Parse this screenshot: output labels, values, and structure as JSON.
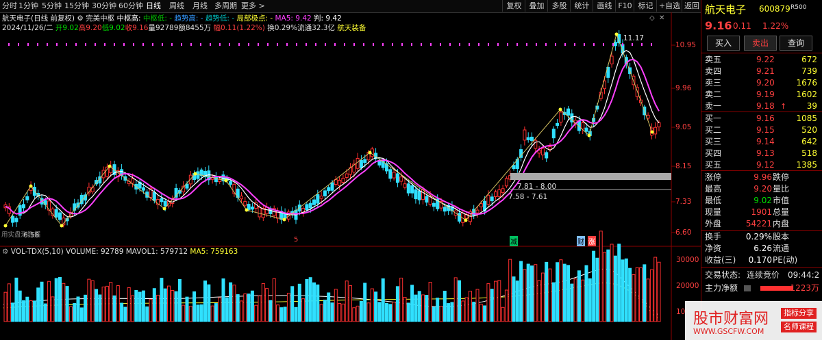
{
  "toolbar": {
    "periods": [
      "分时",
      "1分钟",
      "5分钟",
      "15分钟",
      "30分钟",
      "60分钟",
      "日线",
      "周线",
      "月线",
      "多周期",
      "更多 >"
    ],
    "active_period": "日线",
    "tools": [
      "复权",
      "叠加",
      "多股",
      "统计",
      "画线",
      "F10",
      "标记",
      "+自选",
      "返回"
    ]
  },
  "chart_header": {
    "line1": {
      "stock": "航天电子(日线 前复权)",
      "indicator": "完美中枢",
      "zhongshu_high": "中枢高:",
      "zhongshu_low": "中枢低:",
      "zhongshu_low_val": "-",
      "trend_high": "趋势高:",
      "trend_high_val": "-",
      "trend_low": "趋势低:",
      "trend_low_val": "-",
      "extreme": "局部极点:",
      "extreme_val": "-",
      "ma5": "MA5: 9.42",
      "judge": "判: 9.42"
    },
    "line2": {
      "date": "2024/11/26/二",
      "open": "开9.02",
      "high": "高9.20",
      "low": "低9.02",
      "close": "收9.16",
      "volume": "量92789",
      "amount": "额8455万",
      "change": "幅0.11(1.22%)",
      "turnover": "换0.29%",
      "float": "流通32.3亿",
      "sector": "航天装备"
    }
  },
  "price_axis": [
    "10.95",
    "9.96",
    "9.05",
    "8.15",
    "7.33",
    "6.60"
  ],
  "volume_axis": [
    "30000",
    "20000",
    "10"
  ],
  "annotations": {
    "peak": "11.17",
    "low": "6.58",
    "range1": "7.81 - 8.00",
    "range2": "7.58 - 7.61",
    "left_note": "用实盘测数据",
    "markers": [
      "5",
      "减",
      "财",
      "涨"
    ]
  },
  "volume_header": {
    "name": "VOL-TDX(5,10)",
    "volume": "VOLUME: 92789",
    "mavol1": "MAVOL1: 579712",
    "ma5": "MA5: 759163"
  },
  "right_panel": {
    "name": "航天电子",
    "code": "600879",
    "badge": "R500",
    "price": "9.16",
    "change": "0.11",
    "pct": "1.22%",
    "buttons": [
      "买入",
      "卖出",
      "查询"
    ],
    "asks": [
      {
        "label": "卖五",
        "price": "9.22",
        "vol": "672"
      },
      {
        "label": "卖四",
        "price": "9.21",
        "vol": "739"
      },
      {
        "label": "卖三",
        "price": "9.20",
        "vol": "1676"
      },
      {
        "label": "卖二",
        "price": "9.19",
        "vol": "1602"
      },
      {
        "label": "卖一",
        "price": "9.18",
        "vol": "39"
      }
    ],
    "bids": [
      {
        "label": "买一",
        "price": "9.16",
        "vol": "1085"
      },
      {
        "label": "买二",
        "price": "9.15",
        "vol": "520"
      },
      {
        "label": "买三",
        "price": "9.14",
        "vol": "642"
      },
      {
        "label": "买四",
        "price": "9.13",
        "vol": "518"
      },
      {
        "label": "买五",
        "price": "9.12",
        "vol": "1385"
      }
    ],
    "stats": [
      {
        "l1": "涨停",
        "v1": "9.96",
        "l2": "跌停",
        "v2": ""
      },
      {
        "l1": "最高",
        "v1": "9.20",
        "l2": "量比",
        "v2": ""
      },
      {
        "l1": "最低",
        "v1": "9.02",
        "l2": "市值",
        "v2": ""
      },
      {
        "l1": "现量",
        "v1": "1901",
        "l2": "总量",
        "v2": ""
      },
      {
        "l1": "外盘",
        "v1": "54221",
        "l2": "内盘",
        "v2": ""
      },
      {
        "l1": "换手",
        "v1": "0.29%",
        "l2": "股本",
        "v2": ""
      },
      {
        "l1": "净资",
        "v1": "6.26",
        "l2": "流通",
        "v2": ""
      },
      {
        "l1": "收益(三)",
        "v1": "0.170",
        "l2": "PE(动)",
        "v2": ""
      }
    ],
    "trade_status_label": "交易状态:",
    "trade_status": "连续竞价",
    "time": "09:44:2",
    "main_flow_label": "主力净额",
    "main_flow": "1223万"
  },
  "watermark": {
    "site": "股市财富网",
    "url": "WWW.GSCFW.COM",
    "tag1": "指标分享",
    "tag2": "名师课程"
  }
}
